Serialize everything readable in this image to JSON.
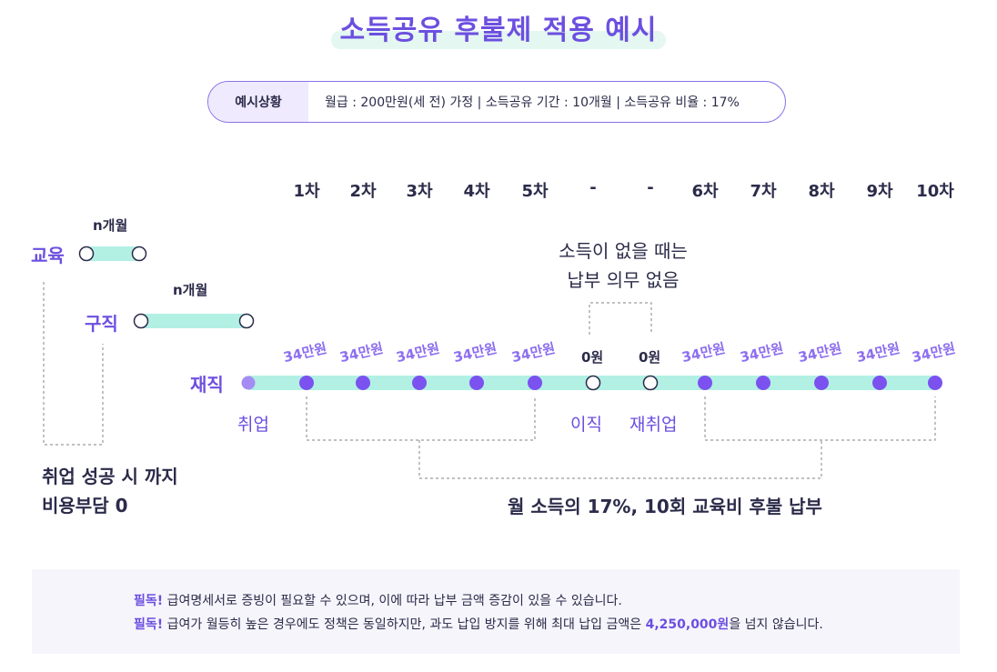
{
  "title": "소득공유 후불제 적용 예시",
  "example_box": {
    "label": "예시상황",
    "text": "월급 : 200만원(세 전) 가정 | 소득공유 기간 : 10개월 | 소득공유 비율 : 17%"
  },
  "columns": [
    "1차",
    "2차",
    "3차",
    "4차",
    "5차",
    "-",
    "-",
    "6차",
    "7차",
    "8차",
    "9차",
    "10차"
  ],
  "rows": {
    "education": {
      "label": "교육",
      "duration": "n개월"
    },
    "job_search": {
      "label": "구직",
      "duration": "n개월"
    },
    "employed": {
      "label": "재직"
    }
  },
  "payments": [
    "34만원",
    "34만원",
    "34만원",
    "34만원",
    "34만원",
    "0원",
    "0원",
    "34만원",
    "34만원",
    "34만원",
    "34만원",
    "34만원"
  ],
  "events": {
    "hire": "취업",
    "leave": "이직",
    "rehire": "재취업"
  },
  "no_income_note": [
    "소득이 없을 때는",
    "납부 의무 없음"
  ],
  "left_note": [
    "취업 성공 시 까지",
    "비용부담 0"
  ],
  "summary": "월 소득의 17%, 10회 교육비 후불 납부",
  "footer": {
    "line1_prefix": "필독!",
    "line1_text": " 급여명세서로 증빙이 필요할 수 있으며, 이에 따라 납부 금액 증감이 있을 수 있습니다.",
    "line2_prefix": "필독!",
    "line2_text": " 급여가 월등히 높은 경우에도 정책은 동일하지만, 과도 납입 방지를 위해 최대 납입 금액은 ",
    "line2_amount": "4,250,000원",
    "line2_suffix": "을 넘지 않습니다."
  },
  "colors": {
    "accent": "#6c4fe0",
    "track": "#b2f0e4",
    "dot": "#7b52f0",
    "light_dot": "#a48cf2"
  }
}
